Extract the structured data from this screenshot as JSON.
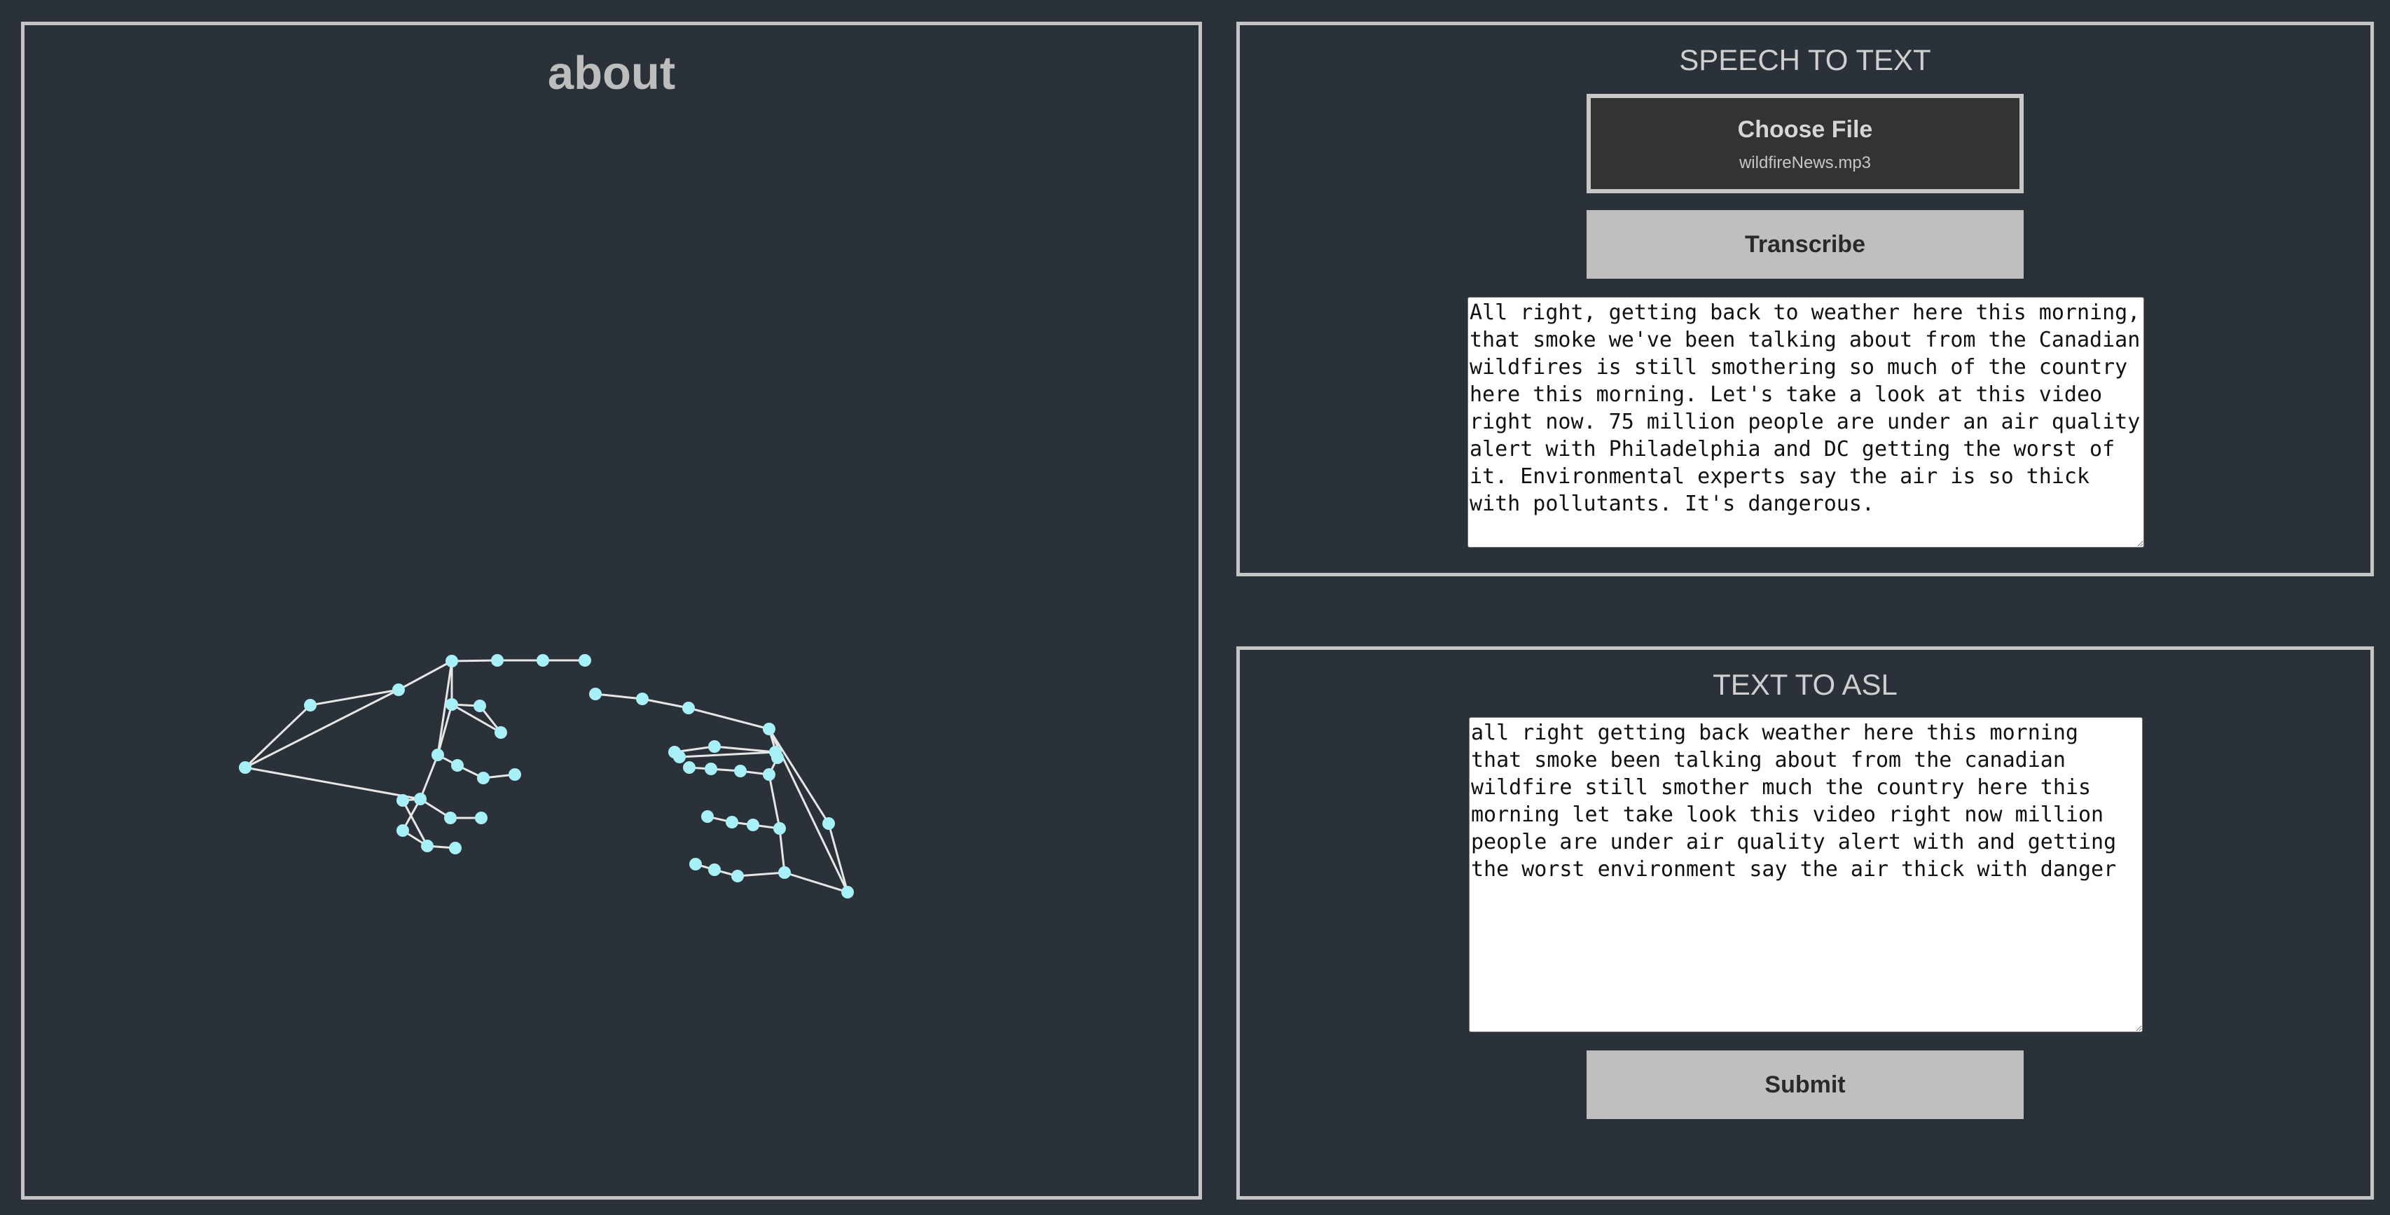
{
  "about_panel": {
    "title": "about"
  },
  "speech_to_text": {
    "title": "SPEECH TO TEXT",
    "file_button_label": "Choose File",
    "selected_file": "wildfireNews.mp3",
    "transcribe_label": "Transcribe",
    "transcript": "All right, getting back to weather here this morning, that smoke we've been talking about from the Canadian wildfires is still smothering so much of the country here this morning. Let's take a look at this video right now. 75 million people are under an air quality alert with Philadelphia and DC getting the worst of it. Environmental experts say the air is so thick with pollutants. It's dangerous."
  },
  "text_to_asl": {
    "title": "TEXT TO ASL",
    "gloss_text": "all right getting back weather here this morning that smoke been talking about from the canadian wildfire still smother much the country here this morning let take look this video right now million people are under air quality alert with and getting the worst environment say the air thick with danger",
    "submit_label": "Submit"
  },
  "colors": {
    "background": "#2a3138",
    "panel_border": "#c4c4c4",
    "landmark_point": "#a8f0f8",
    "landmark_line": "#e6e6e6",
    "button_fill": "#bfbfbf"
  }
}
